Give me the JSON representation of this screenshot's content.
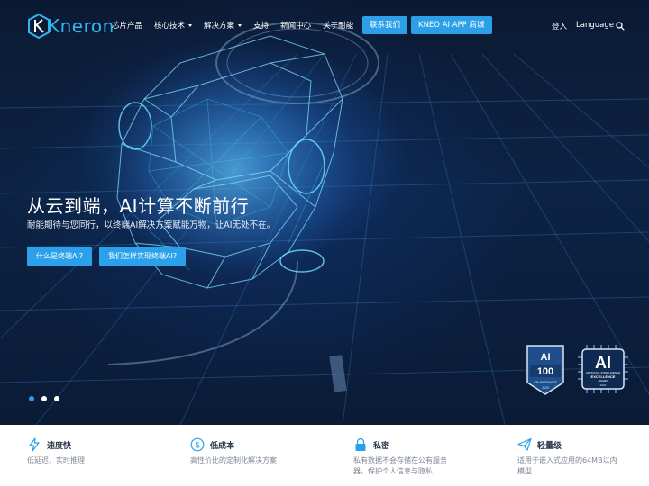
{
  "brand": {
    "logo_text": "Kneron"
  },
  "nav": {
    "items": [
      {
        "label": "芯片产品",
        "dropdown": false
      },
      {
        "label": "核心技术",
        "dropdown": true
      },
      {
        "label": "解决方案",
        "dropdown": true
      },
      {
        "label": "支持",
        "dropdown": false
      },
      {
        "label": "新闻中心",
        "dropdown": false
      },
      {
        "label": "关于耐能",
        "dropdown": false
      }
    ],
    "contact_button": "联系我们",
    "store_button": "KNEO AI APP 商城",
    "login": "登入",
    "language": "Language",
    "search_icon": "search-icon"
  },
  "hero": {
    "headline": "从云到端，AI计算不断前行",
    "subline": "耐能期待与您同行，以终端AI解决方案赋能万物，让AI无处不在。",
    "cta_primary": "什么是终端AI?",
    "cta_secondary": "我们怎样实现终端AI?",
    "slides": 3,
    "active_slide": 1
  },
  "badges": {
    "ai100": {
      "top": "AI",
      "number": "100",
      "brand": "CB INSIGHTS",
      "year": "2020"
    },
    "excellence": {
      "big": "AI",
      "line1": "ARTIFICIAL INTELLIGENCE",
      "line2": "EXCELLENCE",
      "line3": "AWARD",
      "year": "2020"
    }
  },
  "features": [
    {
      "icon": "lightning-icon",
      "title": "速度快",
      "desc": "低延迟，实时推理"
    },
    {
      "icon": "dollar-icon",
      "title": "低成本",
      "desc": "高性价比的定制化解决方案"
    },
    {
      "icon": "lock-icon",
      "title": "私密",
      "desc": "私有数据不会存储在公有服务器，保护个人信息与隐私"
    },
    {
      "icon": "paper-plane-icon",
      "title": "轻量级",
      "desc": "适用于嵌入式应用的64MB以内模型"
    }
  ],
  "colors": {
    "accent": "#2aa1ea",
    "logo": "#2fb6f0",
    "hero_bg": "#0c2344"
  }
}
